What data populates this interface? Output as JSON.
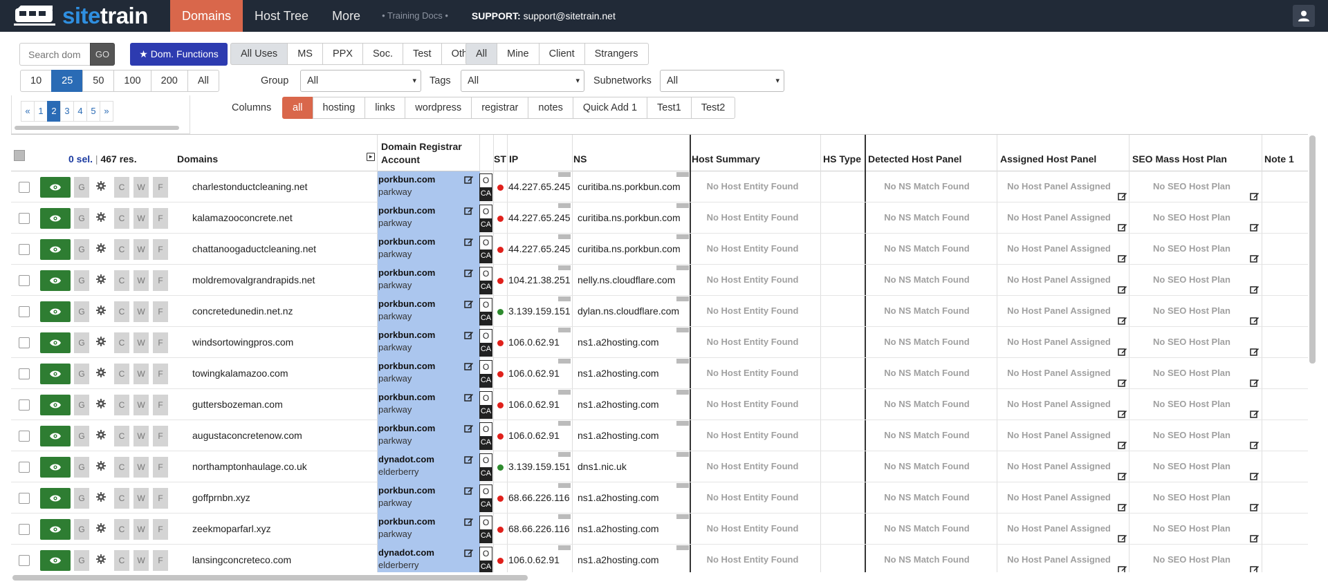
{
  "brand": {
    "part1": "site",
    "part2": "train"
  },
  "nav": {
    "items": [
      {
        "label": "Domains",
        "active": true
      },
      {
        "label": "Host Tree",
        "active": false
      },
      {
        "label": "More",
        "active": false
      }
    ],
    "training": "• Training Docs •",
    "support_label": "SUPPORT:",
    "support_email": "support@sitetrain.net"
  },
  "toolbar": {
    "search_placeholder": "Search dom",
    "go_label": "GO",
    "dom_functions_label": "★ Dom. Functions",
    "uses": [
      {
        "label": "All Uses",
        "selected": true
      },
      {
        "label": "MS"
      },
      {
        "label": "PPX"
      },
      {
        "label": "Soc."
      },
      {
        "label": "Test"
      },
      {
        "label": "Other"
      }
    ],
    "owners": [
      {
        "label": "All",
        "selected": true
      },
      {
        "label": "Mine"
      },
      {
        "label": "Client"
      },
      {
        "label": "Strangers"
      }
    ],
    "page_sizes": [
      {
        "label": "10"
      },
      {
        "label": "25",
        "selected": true
      },
      {
        "label": "50"
      },
      {
        "label": "100"
      },
      {
        "label": "200"
      },
      {
        "label": "All"
      }
    ],
    "group_label": "Group",
    "group_value": "All",
    "tags_label": "Tags",
    "tags_value": "All",
    "subnetworks_label": "Subnetworks",
    "subnetworks_value": "All",
    "columns_label": "Columns",
    "columns": [
      {
        "label": "all",
        "selected": true
      },
      {
        "label": "hosting"
      },
      {
        "label": "links"
      },
      {
        "label": "wordpress"
      },
      {
        "label": "registrar"
      },
      {
        "label": "notes"
      },
      {
        "label": "Quick Add 1"
      },
      {
        "label": "Test1"
      },
      {
        "label": "Test2"
      }
    ],
    "pagination": [
      {
        "label": "«"
      },
      {
        "label": "1"
      },
      {
        "label": "2",
        "current": true
      },
      {
        "label": "3"
      },
      {
        "label": "4"
      },
      {
        "label": "5"
      },
      {
        "label": "»"
      }
    ]
  },
  "table": {
    "sel_count": "0 sel.",
    "sep": "|",
    "res_count": "467 res.",
    "headers": {
      "domains": "Domains",
      "registrar_l1": "Domain Registrar",
      "registrar_l2": "Account",
      "st": "ST",
      "ip": "IP",
      "ns": "NS",
      "host_summary": "Host Summary",
      "hs_type": "HS Type",
      "detected": "Detected Host Panel",
      "assigned": "Assigned Host Panel",
      "seo": "SEO Mass Host Plan",
      "note1": "Note 1"
    },
    "action_letters": {
      "g": "G",
      "c": "C",
      "w": "W",
      "f": "F"
    },
    "oca": {
      "o": "O",
      "ca": "CA"
    },
    "empty": {
      "host": "No Host Entity Found",
      "ns_match": "No NS Match Found",
      "panel": "No Host Panel Assigned",
      "seo": "No SEO Host Plan"
    },
    "status_colors": {
      "red": "#e0201b",
      "green": "#2e8b2e"
    },
    "rows": [
      {
        "domain": "charlestonductcleaning.net",
        "registrar": "porkbun.com",
        "account": "parkway",
        "status": "red",
        "ip": "44.227.65.245",
        "ns": "curitiba.ns.porkbun.com"
      },
      {
        "domain": "kalamazooconcrete.net",
        "registrar": "porkbun.com",
        "account": "parkway",
        "status": "red",
        "ip": "44.227.65.245",
        "ns": "curitiba.ns.porkbun.com"
      },
      {
        "domain": "chattanoogaductcleaning.net",
        "registrar": "porkbun.com",
        "account": "parkway",
        "status": "red",
        "ip": "44.227.65.245",
        "ns": "curitiba.ns.porkbun.com"
      },
      {
        "domain": "moldremovalgrandrapids.net",
        "registrar": "porkbun.com",
        "account": "parkway",
        "status": "red",
        "ip": "104.21.38.251",
        "ns": "nelly.ns.cloudflare.com"
      },
      {
        "domain": "concretedunedin.net.nz",
        "registrar": "porkbun.com",
        "account": "parkway",
        "status": "green",
        "ip": "3.139.159.151",
        "ns": "dylan.ns.cloudflare.com"
      },
      {
        "domain": "windsortowingpros.com",
        "registrar": "porkbun.com",
        "account": "parkway",
        "status": "red",
        "ip": "106.0.62.91",
        "ns": "ns1.a2hosting.com"
      },
      {
        "domain": "towingkalamazoo.com",
        "registrar": "porkbun.com",
        "account": "parkway",
        "status": "red",
        "ip": "106.0.62.91",
        "ns": "ns1.a2hosting.com"
      },
      {
        "domain": "guttersbozeman.com",
        "registrar": "porkbun.com",
        "account": "parkway",
        "status": "red",
        "ip": "106.0.62.91",
        "ns": "ns1.a2hosting.com"
      },
      {
        "domain": "augustaconcretenow.com",
        "registrar": "porkbun.com",
        "account": "parkway",
        "status": "red",
        "ip": "106.0.62.91",
        "ns": "ns1.a2hosting.com"
      },
      {
        "domain": "northamptonhaulage.co.uk",
        "registrar": "dynadot.com",
        "account": "elderberry",
        "status": "green",
        "ip": "3.139.159.151",
        "ns": "dns1.nic.uk"
      },
      {
        "domain": "goffprnbn.xyz",
        "registrar": "porkbun.com",
        "account": "parkway",
        "status": "red",
        "ip": "68.66.226.116",
        "ns": "ns1.a2hosting.com"
      },
      {
        "domain": "zeekmoparfarl.xyz",
        "registrar": "porkbun.com",
        "account": "parkway",
        "status": "red",
        "ip": "68.66.226.116",
        "ns": "ns1.a2hosting.com"
      },
      {
        "domain": "lansingconcreteco.com",
        "registrar": "dynadot.com",
        "account": "elderberry",
        "status": "red",
        "ip": "106.0.62.91",
        "ns": "ns1.a2hosting.com"
      }
    ]
  }
}
